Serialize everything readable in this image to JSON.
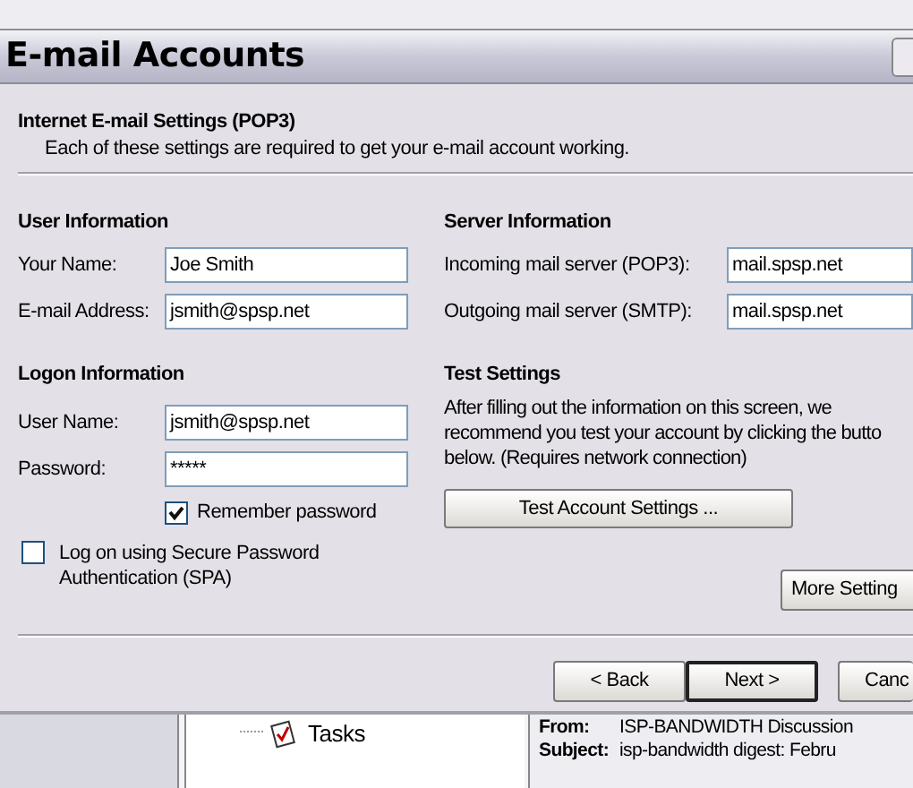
{
  "dialog": {
    "title": "E-mail Accounts"
  },
  "header": {
    "title": "Internet E-mail Settings (POP3)",
    "subtitle": "Each of these settings are required to get your e-mail account working."
  },
  "user_information": {
    "heading": "User Information",
    "fields": [
      {
        "label": "Your Name:",
        "value": "Joe Smith"
      },
      {
        "label": "E-mail Address:",
        "value": "jsmith@spsp.net"
      }
    ]
  },
  "logon_information": {
    "heading": "Logon Information",
    "fields": [
      {
        "label": "User Name:",
        "value": "jsmith@spsp.net"
      },
      {
        "label": "Password:",
        "value": "*****"
      }
    ],
    "remember_password": {
      "label": "Remember password",
      "checked": true
    },
    "spa": {
      "label": "Log on using Secure Password Authentication (SPA)",
      "checked": false
    }
  },
  "server_information": {
    "heading": "Server Information",
    "fields": [
      {
        "label": "Incoming mail server (POP3):",
        "value": "mail.spsp.net"
      },
      {
        "label": "Outgoing mail server (SMTP):",
        "value": "mail.spsp.net"
      }
    ]
  },
  "test_settings": {
    "heading": "Test Settings",
    "description": [
      "After filling out the information on this screen, we",
      "recommend you test your account by clicking the butto",
      "below. (Requires network connection)"
    ],
    "button": "Test Account Settings ..."
  },
  "more_settings_button": "More Setting",
  "buttons": [
    {
      "label": "< Back",
      "default": false
    },
    {
      "label": "Next >",
      "default": true
    },
    {
      "label": "Canc",
      "default": false
    }
  ],
  "background": {
    "tree_item": "Tasks",
    "message_header": [
      {
        "label": "From:",
        "value": "ISP-BANDWIDTH Discussion"
      },
      {
        "label": "Subject:",
        "value": "isp-bandwidth digest: Febru"
      }
    ]
  }
}
